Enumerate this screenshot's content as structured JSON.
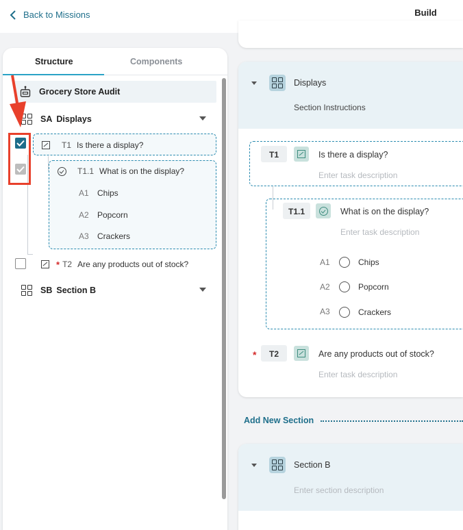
{
  "topbar": {
    "back_label": "Back to Missions",
    "build_tab": "Build"
  },
  "left_panel": {
    "tabs": [
      {
        "label": "Structure",
        "active": true
      },
      {
        "label": "Components",
        "active": false
      }
    ],
    "root": {
      "label": "Grocery Store Audit",
      "icon": "robot-icon"
    },
    "section_a": {
      "code": "SA",
      "name": "Displays"
    },
    "task_t1": {
      "code": "T1",
      "label": "Is there a display?",
      "checked": true
    },
    "task_t11": {
      "code": "T1.1",
      "label": "What is on the display?",
      "checked": true,
      "answers": [
        {
          "code": "A1",
          "label": "Chips"
        },
        {
          "code": "A2",
          "label": "Popcorn"
        },
        {
          "code": "A3",
          "label": "Crackers"
        }
      ]
    },
    "task_t2": {
      "code": "T2",
      "label": "Are any products out of stock?",
      "required": true,
      "checked": false
    },
    "section_b": {
      "code": "SB",
      "name": "Section B"
    }
  },
  "right_panel": {
    "section_displays": {
      "title": "Displays",
      "instructions": "Section Instructions"
    },
    "task_t1": {
      "code": "T1",
      "question": "Is there a display?",
      "placeholder": "Enter task description"
    },
    "task_t11": {
      "code": "T1.1",
      "question": "What is on the display?",
      "placeholder": "Enter task description",
      "answers": [
        {
          "code": "A1",
          "label": "Chips"
        },
        {
          "code": "A2",
          "label": "Popcorn"
        },
        {
          "code": "A3",
          "label": "Crackers"
        }
      ]
    },
    "task_t2": {
      "code": "T2",
      "question": "Are any products out of stock?",
      "placeholder": "Enter task description",
      "required": true
    },
    "add_section": "Add New Section",
    "section_b": {
      "title": "Section B",
      "placeholder": "Enter section description"
    }
  },
  "colors": {
    "accent": "#2aa3c6",
    "link": "#1f6f8b",
    "checkbox_checked": "#1d6d8a",
    "highlight_annotation": "#e8402b",
    "required_star": "#d42a2a"
  }
}
